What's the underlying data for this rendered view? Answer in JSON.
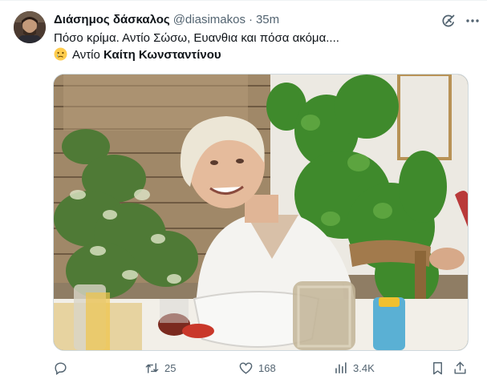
{
  "author": {
    "display_name": "Διάσημος δάσκαλος",
    "handle": "@diasimakos",
    "separator": "·",
    "time": "35m"
  },
  "tweet": {
    "line1": "Πόσο κρίμα. Αντίο Σώσω, Ευανθια και πόσα ακόμα....",
    "line2_emoji": "crying-face",
    "line2_prefix": "Αντίο",
    "line2_name": "Καίτη Κωνσταντίνου"
  },
  "actions": {
    "replies": "",
    "retweets": "25",
    "likes": "168",
    "views": "3.4K"
  },
  "colors": {
    "text": "#0f1419",
    "secondary": "#536471",
    "border": "#cfd9de"
  },
  "icons": {
    "grok": "grok-icon",
    "more": "more-icon",
    "reply": "reply-icon",
    "retweet": "retweet-icon",
    "like": "heart-icon",
    "views": "views-icon",
    "bookmark": "bookmark-icon",
    "share": "share-icon"
  }
}
